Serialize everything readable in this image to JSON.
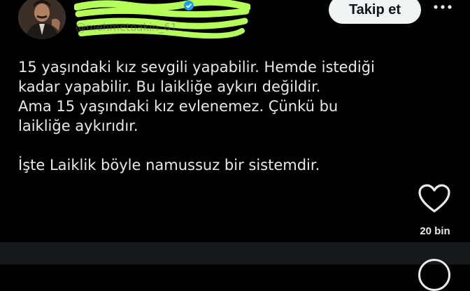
{
  "header": {
    "handle": "@mehmetoakin_61",
    "follow_label": "Takip et",
    "scribble_color": "#b6ff5a"
  },
  "tweet": {
    "lines_block1": [
      "15 yaşındaki kız sevgili yapabilir. Hemde istediği",
      "kadar yapabilir. Bu laikliğe aykırı değildir.",
      "Ama 15 yaşındaki kız evlenemez. Çünkü bu",
      "laikliğe aykırıdır."
    ],
    "line_block2": "İşte Laiklik böyle namussuz bir sistemdir."
  },
  "actions": {
    "like_icon": "heart-outline-icon",
    "like_count": "20 bin",
    "more_icon": "more-horizontal-icon"
  },
  "colors": {
    "background": "#000000",
    "text": "#e7e9ea",
    "secondary_text": "#71767b",
    "follow_bg": "#eff3f4",
    "bottom_bar": "#15181c"
  }
}
